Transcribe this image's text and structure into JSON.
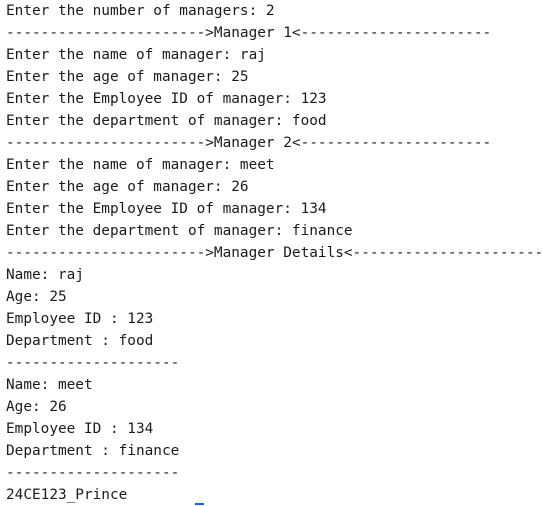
{
  "console": {
    "lines": [
      "Enter the number of managers: 2",
      "----------------------->Manager 1<----------------------",
      "Enter the name of manager: raj",
      "Enter the age of manager: 25",
      "Enter the Employee ID of manager: 123",
      "Enter the department of manager: food",
      "----------------------->Manager 2<----------------------",
      "Enter the name of manager: meet",
      "Enter the age of manager: 26",
      "Enter the Employee ID of manager: 134",
      "Enter the department of manager: finance",
      "----------------------->Manager Details<----------------------",
      "Name: raj",
      "Age: 25",
      "Employee ID : 123",
      "Department : food",
      "--------------------",
      "Name: meet",
      "Age: 26",
      "Employee ID : 134",
      "Department : finance",
      "--------------------",
      "24CE123_Prince"
    ]
  },
  "colors": {
    "text": "#1b1b1b",
    "background": "#ffffff",
    "cursor": "#0e66c9"
  }
}
